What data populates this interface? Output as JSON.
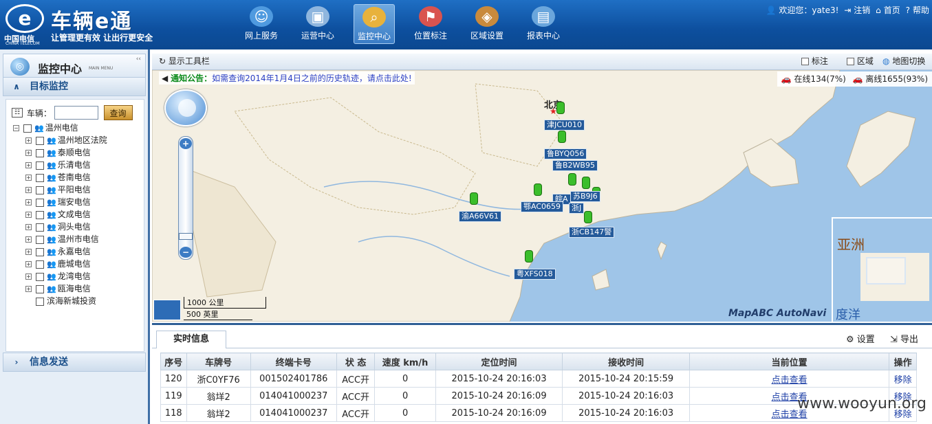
{
  "header": {
    "brand_logo_cn": "中国电信",
    "brand_logo_en": "CHINA TELECOM",
    "product_title": "车辆e通",
    "slogan": "让管理更有效 让出行更安全",
    "nav": [
      {
        "label": "网上服务",
        "icon": "chat-bubble-icon"
      },
      {
        "label": "运营中心",
        "icon": "monitor-icon"
      },
      {
        "label": "监控中心",
        "icon": "magnifier-icon",
        "active": true
      },
      {
        "label": "位置标注",
        "icon": "map-pin-icon"
      },
      {
        "label": "区域设置",
        "icon": "region-icon"
      },
      {
        "label": "报表中心",
        "icon": "chart-icon"
      }
    ],
    "user": {
      "welcome": "欢迎您：yate3!",
      "logout": "注销",
      "home": "首页",
      "help": "帮助"
    }
  },
  "sidebar": {
    "title": "监控中心",
    "subtitle": "MAIN MENU",
    "section_target": "目标监控",
    "search": {
      "label": "车辆：",
      "value": "",
      "button": "查询"
    },
    "tree_root": "温州电信",
    "tree_children": [
      "温州地区法院",
      "泰顺电信",
      "乐清电信",
      "苍南电信",
      "平阳电信",
      "瑞安电信",
      "文成电信",
      "洞头电信",
      "温州市电信",
      "永嘉电信",
      "鹿城电信",
      "龙湾电信",
      "瓯海电信",
      "滨海新城投资"
    ],
    "section_message": "信息发送"
  },
  "map_toolbar": {
    "show_toolbar": "显示工具栏",
    "mark": "标注",
    "area": "区域",
    "switch_map": "地图切换"
  },
  "map": {
    "notice_label": "通知公告：",
    "notice_text": "如需查询2014年1月4日之前的历史轨迹，请点击此处!",
    "online": "在线134(7%)",
    "offline": "离线1655(93%)",
    "city_label": "北京",
    "vehicle_tags": [
      "津JCU010",
      "鲁BYQ056",
      "鲁B2WB95",
      "苏B9J6",
      "皖A",
      "浙J",
      "浙CB147警",
      "鄂AC0659",
      "渝A66V61",
      "粤XFS018"
    ],
    "scale_km": "1000 公里",
    "scale_mi": "500 英里",
    "minimap_label": "亚洲",
    "minimap_sea": "度洋",
    "attribution": "MapABC AutoNavi"
  },
  "bottom": {
    "tab": "实时信息",
    "settings": "设置",
    "export": "导出",
    "columns": [
      "序号",
      "车牌号",
      "终端卡号",
      "状 态",
      "速度 km/h",
      "定位时间",
      "接收时间",
      "当前位置",
      "操作"
    ],
    "rows": [
      [
        "120",
        "浙C0YF76",
        "001502401786",
        "ACC开",
        "0",
        "2015-10-24 20:16:03",
        "2015-10-24 20:15:59",
        "点击查看",
        "移除"
      ],
      [
        "119",
        "翁垟2",
        "014041000237",
        "ACC开",
        "0",
        "2015-10-24 20:16:09",
        "2015-10-24 20:16:03",
        "点击查看",
        "移除"
      ],
      [
        "118",
        "翁垟2",
        "014041000237",
        "ACC开",
        "0",
        "2015-10-24 20:16:09",
        "2015-10-24 20:16:03",
        "点击查看",
        "移除"
      ]
    ]
  },
  "watermark": "www.wooyun.org",
  "colors": {
    "header_blue": "#0d4f9e",
    "online_green": "#3bbe2b",
    "offline_red": "#d03a2a",
    "sea": "#9fc5e8"
  }
}
